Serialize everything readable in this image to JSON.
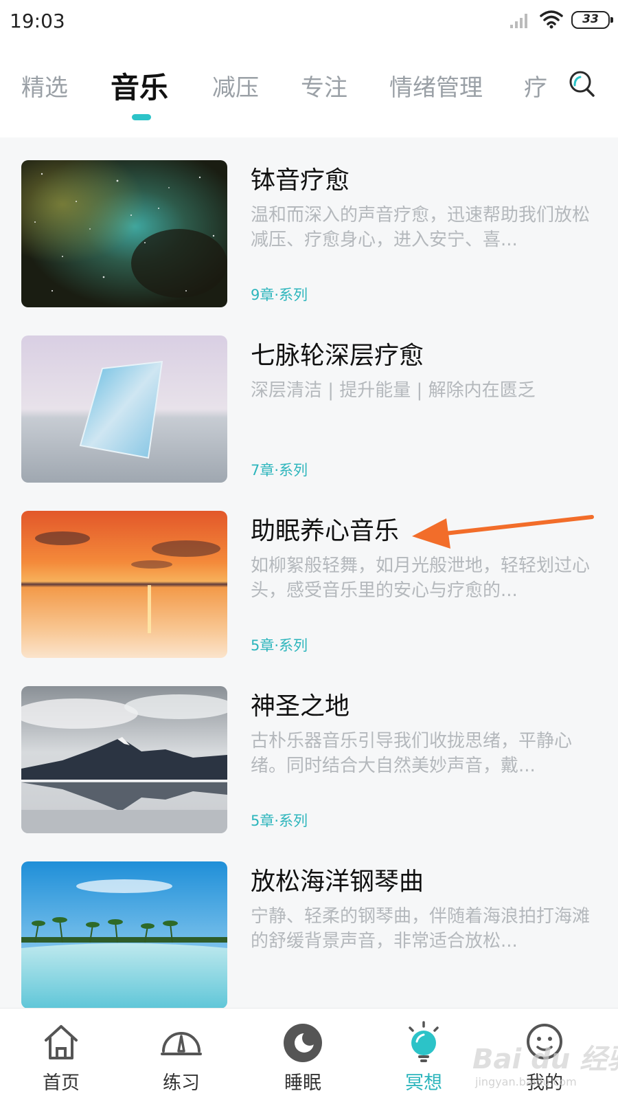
{
  "status_bar": {
    "time": "19:03",
    "battery": "33"
  },
  "tabs": [
    {
      "label": "精选",
      "active": false
    },
    {
      "label": "音乐",
      "active": true
    },
    {
      "label": "减压",
      "active": false
    },
    {
      "label": "专注",
      "active": false
    },
    {
      "label": "情绪管理",
      "active": false
    },
    {
      "label": "疗",
      "active": false
    }
  ],
  "items": [
    {
      "title": "钵音疗愈",
      "desc": "温和而深入的声音疗愈，迅速帮助我们放松减压、疗愈身心，进入安宁、喜...",
      "meta": "9章·系列",
      "image": "nebula"
    },
    {
      "title": "七脉轮深层疗愈",
      "desc": "深层清洁 | 提升能量 | 解除内在匮乏",
      "meta": "7章·系列",
      "image": "mirror-sky"
    },
    {
      "title": "助眠养心音乐",
      "desc": "如柳絮般轻舞，如月光般泄地，轻轻划过心头，感受音乐里的安心与疗愈的...",
      "meta": "5章·系列",
      "image": "sunset-sea"
    },
    {
      "title": "神圣之地",
      "desc": "古朴乐器音乐引导我们收拢思绪，平静心绪。同时结合大自然美妙声音，戴...",
      "meta": "5章·系列",
      "image": "mountain-lake"
    },
    {
      "title": "放松海洋钢琴曲",
      "desc": "宁静、轻柔的钢琴曲，伴随着海浪拍打海滩的舒缓背景声音，非常适合放松...",
      "meta": "",
      "image": "tropical-beach"
    }
  ],
  "bottom_nav": [
    {
      "label": "首页",
      "icon": "home-icon",
      "active": false
    },
    {
      "label": "练习",
      "icon": "gauge-icon",
      "active": false
    },
    {
      "label": "睡眠",
      "icon": "moon-icon",
      "active": false
    },
    {
      "label": "冥想",
      "icon": "lightbulb-icon",
      "active": true
    },
    {
      "label": "我的",
      "icon": "smiley-icon",
      "active": false
    }
  ],
  "watermark": {
    "main": "Bai du 经验",
    "sub": "jingyan.baidu.com"
  },
  "colors": {
    "accent": "#2cc3c8",
    "arrow": "#f26d2a",
    "inactive_tab": "#9aa0a6"
  }
}
